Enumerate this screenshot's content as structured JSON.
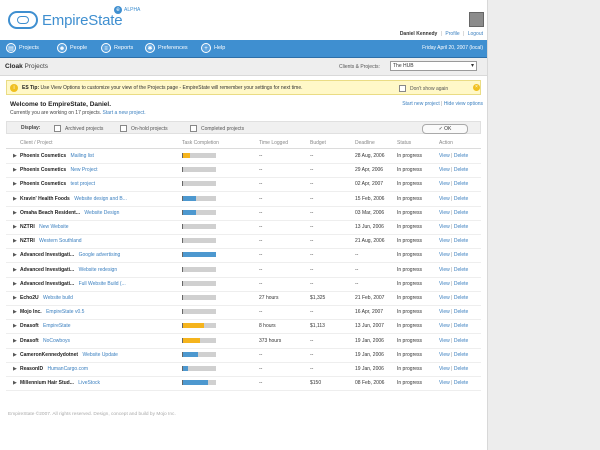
{
  "app": {
    "name": "EmpireState",
    "badge": "ALPHA"
  },
  "user": {
    "name": "Daniel Kennedy",
    "profile": "Profile",
    "logout": "Logout"
  },
  "nav": {
    "items": [
      {
        "label": "Projects",
        "icon": "folder-icon"
      },
      {
        "label": "People",
        "icon": "people-icon"
      },
      {
        "label": "Reports",
        "icon": "reports-icon"
      },
      {
        "label": "Preferences",
        "icon": "gear-icon"
      },
      {
        "label": "Help",
        "icon": "help-icon"
      }
    ],
    "date": "Friday April 20, 2007 (local)"
  },
  "page": {
    "title_bold": "Cloak",
    "title_rest": "Projects",
    "filter_label": "Clients & Projects:",
    "filter_value": "The HUB"
  },
  "tip": {
    "label": "ES Tip:",
    "text": "Use View Options to customize your view of the Projects page - EmpireState will remember your settings for next time.",
    "dont_show": "Don't show again"
  },
  "welcome": {
    "title": "Welcome to EmpireState, Daniel.",
    "sub": "Currently you are working on 17 projects.",
    "sub_link": "Start a new project.",
    "right_link1": "Start new project",
    "right_link2": "Hide view options"
  },
  "display": {
    "label": "Display:",
    "options": [
      "Archived projects",
      "On-hold projects",
      "Completed projects"
    ],
    "ok": "OK"
  },
  "table": {
    "headers": [
      "Client / Project",
      "Task Completion",
      "Time Logged",
      "Budget",
      "Deadline",
      "Status",
      "Action"
    ],
    "rows": [
      {
        "client": "Phoenix Cosmetics",
        "project": "Mailing list",
        "progress": 0.2,
        "color": "#f5b41d",
        "time": "--",
        "budget": "--",
        "deadline": "28 Aug, 2006",
        "status": "In progress"
      },
      {
        "client": "Phoenix Cosmetics",
        "project": "New Project",
        "progress": 0.0,
        "color": "#4d98cf",
        "time": "--",
        "budget": "--",
        "deadline": "29 Apr, 2006",
        "status": "In progress"
      },
      {
        "client": "Phoenix Cosmetics",
        "project": "test project",
        "progress": 0.0,
        "color": "#4d98cf",
        "time": "--",
        "budget": "--",
        "deadline": "02 Apr, 2007",
        "status": "In progress"
      },
      {
        "client": "Kravin' Health Foods",
        "project": "Website design and B...",
        "progress": 0.4,
        "color": "#4d98cf",
        "time": "--",
        "budget": "--",
        "deadline": "15 Feb, 2006",
        "status": "In progress"
      },
      {
        "client": "Omaha Beach Resident...",
        "project": "Website Design",
        "progress": 0.4,
        "color": "#4d98cf",
        "time": "--",
        "budget": "--",
        "deadline": "03 Mar, 2006",
        "status": "In progress"
      },
      {
        "client": "NZTRI",
        "project": "New Website",
        "progress": 0.0,
        "color": "#4d98cf",
        "time": "--",
        "budget": "--",
        "deadline": "13 Jun, 2006",
        "status": "In progress"
      },
      {
        "client": "NZTRI",
        "project": "Western Southland",
        "progress": 0.0,
        "color": "#4d98cf",
        "time": "--",
        "budget": "--",
        "deadline": "21 Aug, 2006",
        "status": "In progress"
      },
      {
        "client": "Advanced Investigati...",
        "project": "Google advertising",
        "progress": 1.0,
        "color": "#4d98cf",
        "time": "--",
        "budget": "--",
        "deadline": "--",
        "status": "In progress"
      },
      {
        "client": "Advanced Investigati...",
        "project": "Website redesign",
        "progress": 0.0,
        "color": "#4d98cf",
        "time": "--",
        "budget": "--",
        "deadline": "--",
        "status": "In progress"
      },
      {
        "client": "Advanced Investigati...",
        "project": "Full Website Build (...",
        "progress": 0.0,
        "color": "#4d98cf",
        "time": "--",
        "budget": "--",
        "deadline": "--",
        "status": "In progress"
      },
      {
        "client": "Echo2U",
        "project": "Website build",
        "progress": 0.0,
        "color": "#4d98cf",
        "time": "27 hours",
        "budget": "$1,325",
        "deadline": "21 Feb, 2007",
        "status": "In progress"
      },
      {
        "client": "Mojo Inc.",
        "project": "EmpireState v0.5",
        "progress": 0.0,
        "color": "#4d98cf",
        "time": "--",
        "budget": "--",
        "deadline": "16 Apr, 2007",
        "status": "In progress"
      },
      {
        "client": "Dnasoft",
        "project": "EmpireState",
        "progress": 0.65,
        "color": "#f5b41d",
        "time": "8 hours",
        "budget": "$1,113",
        "deadline": "13 Jun, 2007",
        "status": "In progress"
      },
      {
        "client": "Dnasoft",
        "project": "NoCowboys",
        "progress": 0.5,
        "color": "#f5b41d",
        "time": "373 hours",
        "budget": "--",
        "deadline": "19 Jan, 2006",
        "status": "In progress"
      },
      {
        "client": "CameronKennedydotnet",
        "project": "Website Update",
        "progress": 0.45,
        "color": "#4d98cf",
        "time": "--",
        "budget": "--",
        "deadline": "19 Jan, 2006",
        "status": "In progress"
      },
      {
        "client": "ReasonID",
        "project": "HumanCargo.com",
        "progress": 0.15,
        "color": "#4d98cf",
        "time": "--",
        "budget": "--",
        "deadline": "19 Jan, 2006",
        "status": "In progress"
      },
      {
        "client": "Millennium Hair Stud...",
        "project": "LiveStock",
        "progress": 0.75,
        "color": "#4d98cf",
        "time": "--",
        "budget": "$150",
        "deadline": "08 Feb, 2006",
        "status": "In progress"
      }
    ],
    "action_view": "View",
    "action_delete": "Delete"
  },
  "footer": "EmpireState ©2007. All rights reserved. Design, concept and build by Mojo Inc."
}
